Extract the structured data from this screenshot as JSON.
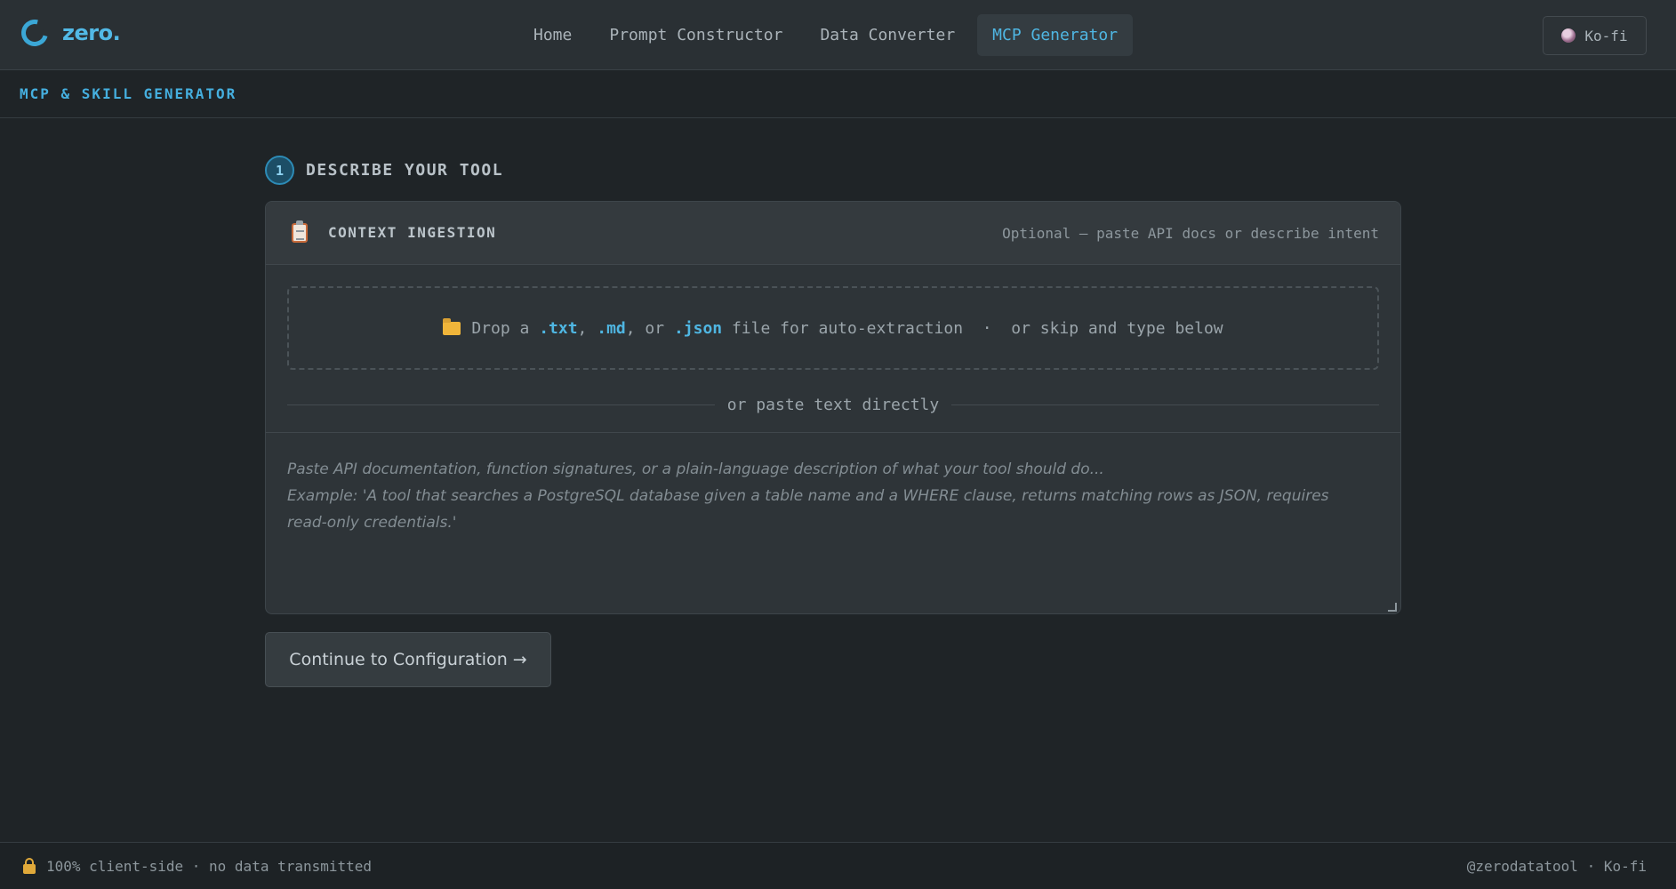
{
  "header": {
    "brand": "zero.",
    "nav": [
      {
        "label": "Home"
      },
      {
        "label": "Prompt Constructor"
      },
      {
        "label": "Data Converter"
      },
      {
        "label": "MCP Generator",
        "active": true
      }
    ],
    "kofi_label": "Ko-fi"
  },
  "subheader": {
    "title": "MCP & SKILL GENERATOR"
  },
  "step": {
    "number": "1",
    "title": "DESCRIBE YOUR TOOL"
  },
  "card": {
    "icon": "clipboard-icon",
    "title": "CONTEXT INGESTION",
    "hint": "Optional — paste API docs or describe intent",
    "dropzone": {
      "icon": "folder-icon",
      "prefix": "Drop a ",
      "ext1": ".txt",
      "sep1": ", ",
      "ext2": ".md",
      "sep2": ", or ",
      "ext3": ".json",
      "suffix": " file for auto-extraction  ·  or skip and type below"
    },
    "divider_text": "or paste text directly",
    "textarea": {
      "placeholder_line1": "Paste API documentation, function signatures, or a plain-language description of what your tool should do...",
      "placeholder_line2": "Example: 'A tool that searches a PostgreSQL database given a table name and a WHERE clause, returns matching rows as JSON, requires read-only credentials.'"
    }
  },
  "continue_label": "Continue to Configuration →",
  "footer": {
    "left": "100% client-side · no data transmitted",
    "right": "@zerodatatool · Ko-fi"
  },
  "colors": {
    "accent": "#4fb6e2",
    "background": "#1f2427",
    "panel": "#2e3438"
  }
}
